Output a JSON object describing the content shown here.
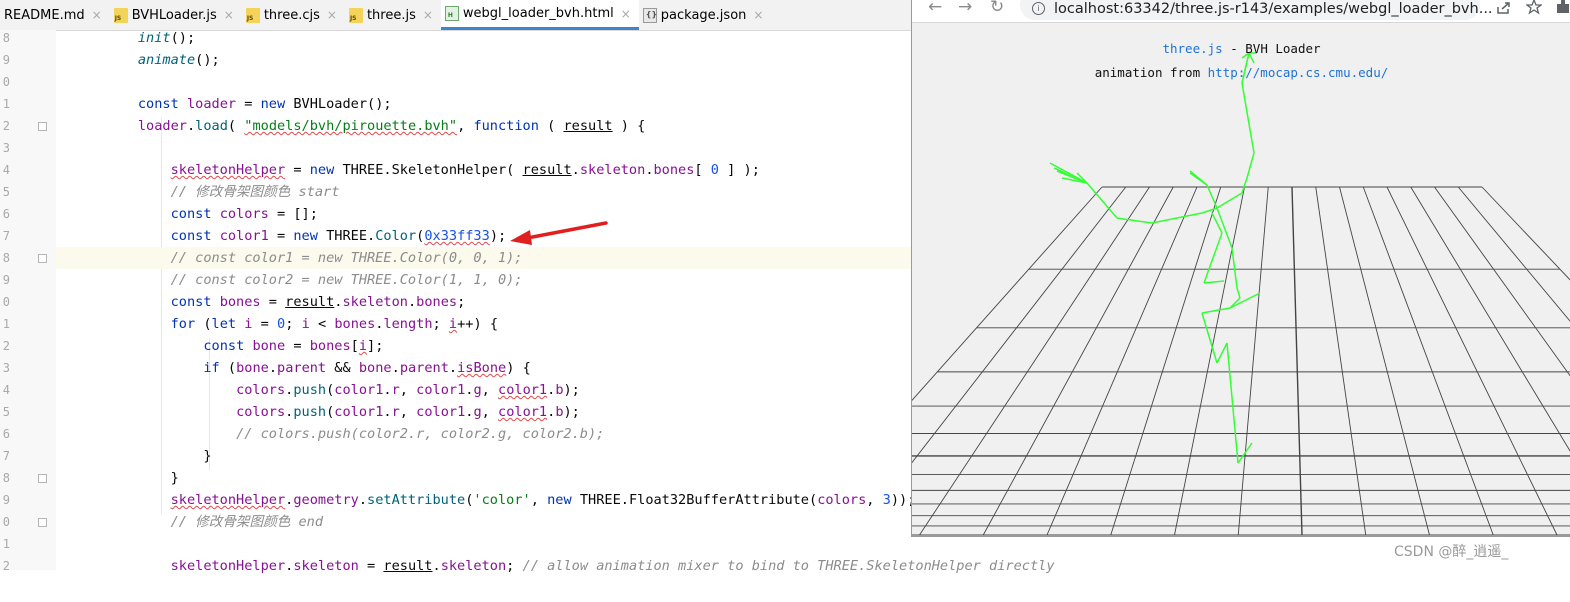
{
  "ide": {
    "tabs": [
      {
        "label": "README.md",
        "icon": "markdown-file-icon",
        "active": false
      },
      {
        "label": "BVHLoader.js",
        "icon": "js-file-icon",
        "active": false
      },
      {
        "label": "three.cjs",
        "icon": "js-file-icon",
        "active": false
      },
      {
        "label": "three.js",
        "icon": "js-file-icon",
        "active": false
      },
      {
        "label": "webgl_loader_bvh.html",
        "icon": "html-file-icon",
        "active": true
      },
      {
        "label": "package.json",
        "icon": "json-file-icon",
        "active": false
      }
    ],
    "gutter_numbers": [
      "8",
      "9",
      "0",
      "1",
      "2",
      "3",
      "4",
      "5",
      "6",
      "7",
      "8",
      "9",
      "0",
      "1",
      "2",
      "3",
      "4",
      "5",
      "6",
      "7",
      "8",
      "9",
      "0",
      "1",
      "2"
    ]
  },
  "browser": {
    "url": "localhost:63342/three.js-r143/examples/webgl_loader_bvh...",
    "nav": {
      "back": "←",
      "forward": "→",
      "reload": "↻"
    },
    "page": {
      "title_link": "three.js",
      "title_rest": " - BVH Loader",
      "credit_prefix": "animation from ",
      "credit_link": "http://mocap.cs.cmu.edu/"
    }
  },
  "watermark": "CSDN @醉_逍遥_",
  "colors": {
    "skeleton": "#33ff33",
    "grid": "#444444",
    "annotation_arrow": "#e0201e",
    "viewport_bg": "#f0f0f0"
  }
}
